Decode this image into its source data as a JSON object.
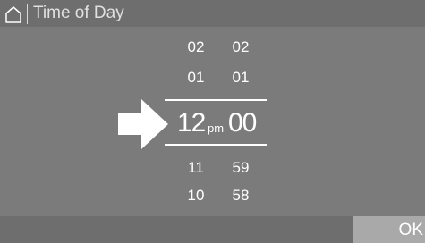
{
  "header": {
    "title": "Time of Day",
    "home_icon": "home-icon"
  },
  "picker": {
    "hours_above": [
      "02",
      "01"
    ],
    "minutes_above": [
      "02",
      "01"
    ],
    "selected": {
      "hour": "12",
      "ampm": "pm",
      "minute": "00"
    },
    "hours_below": [
      "11",
      "10"
    ],
    "minutes_below": [
      "59",
      "58"
    ],
    "pointer_icon": "arrow-right-icon"
  },
  "footer": {
    "ok_label": "OK"
  },
  "colors": {
    "background": "#7b7b7b",
    "bar": "#6e6e6e",
    "ok_button": "#a9a9a9",
    "text": "#ffffff"
  }
}
